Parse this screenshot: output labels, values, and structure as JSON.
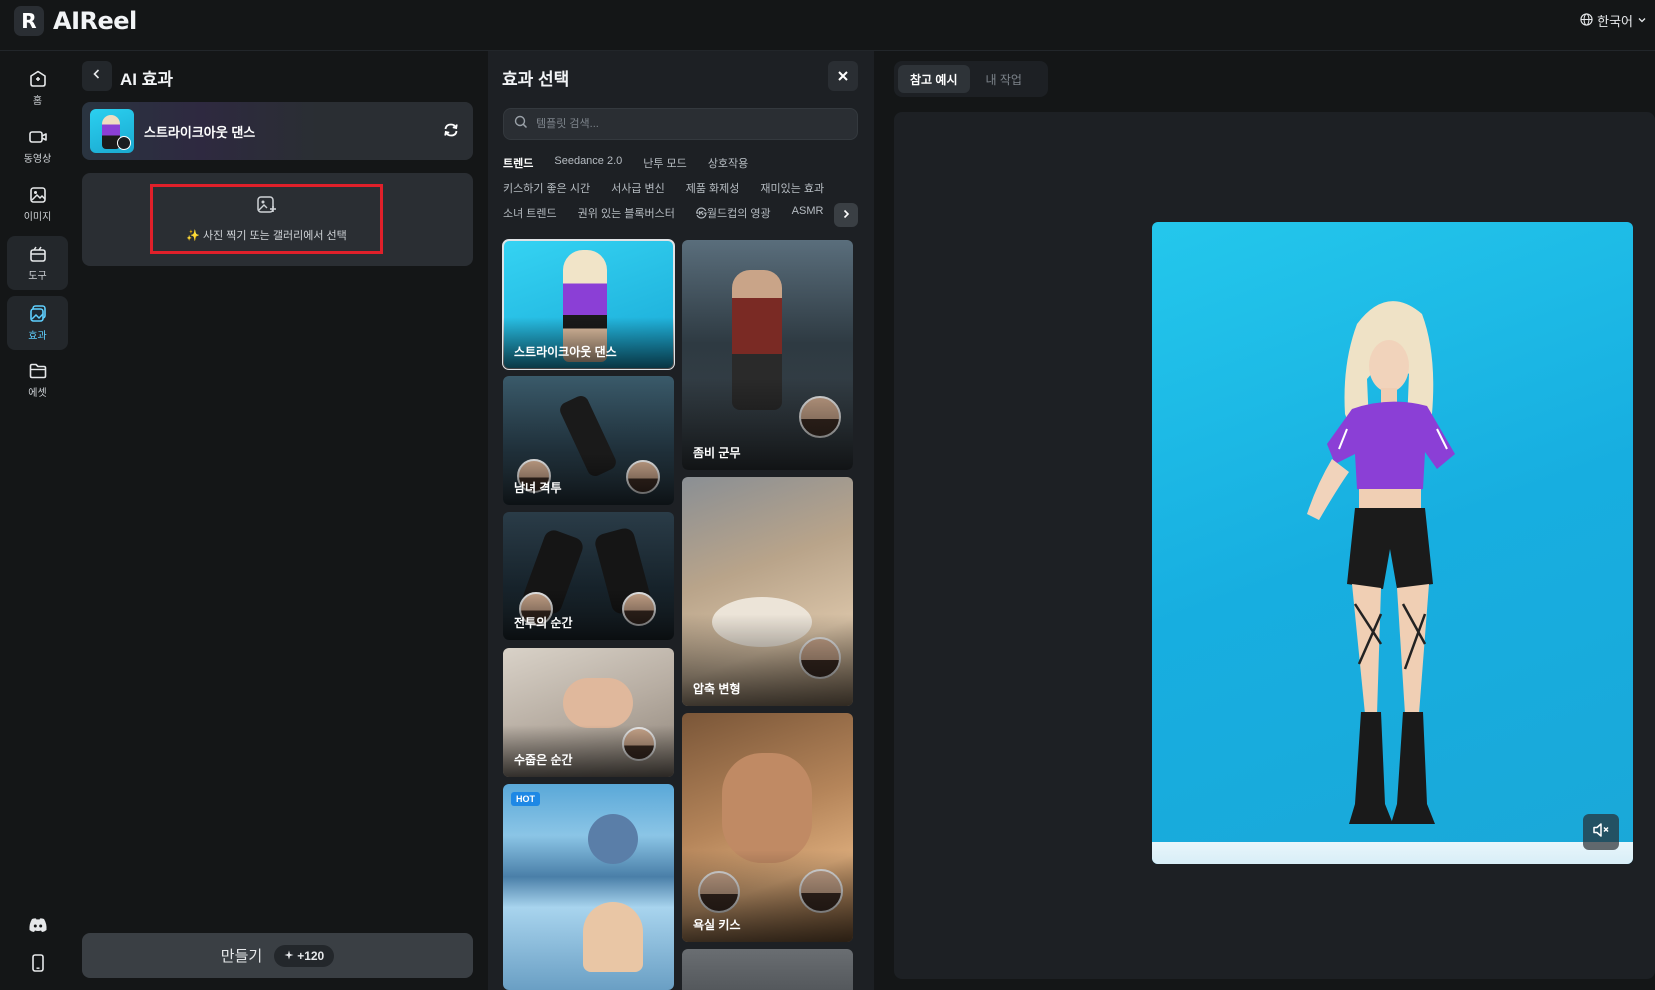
{
  "header": {
    "logo_mark": "R",
    "brand": "AIReel",
    "language": "한국어"
  },
  "sidebar": {
    "items": [
      {
        "label": "홈",
        "icon": "home-icon"
      },
      {
        "label": "동영상",
        "icon": "video-icon"
      },
      {
        "label": "이미지",
        "icon": "image-icon"
      },
      {
        "label": "도구",
        "icon": "tools-icon"
      },
      {
        "label": "효과",
        "icon": "effects-icon"
      },
      {
        "label": "에셋",
        "icon": "folder-icon"
      }
    ],
    "bottom_icons": [
      "discord-icon",
      "mobile-icon"
    ]
  },
  "left_panel": {
    "title": "AI 효과",
    "selected_effect": "스트라이크아웃 댄스",
    "upload_text": "✨ 사진 찍기 또는 갤러리에서 선택",
    "create_label": "만들기",
    "credit_cost": "+120"
  },
  "effect_select": {
    "title": "효과 선택",
    "search_placeholder": "템플릿 검색...",
    "tags_row1": [
      "트렌드",
      "Seedance 2.0",
      "난투 모드",
      "상호작용"
    ],
    "tags_row2": [
      "키스하기 좋은 시간",
      "서사급 변신",
      "제품 화제성",
      "재미있는 효과"
    ],
    "tags_row3": [
      "소녀 트렌드",
      "권위 있는 블록버스터",
      "㉿월드컵의 영광",
      "ASMR"
    ],
    "cards": [
      {
        "caption": "스트라이크아웃 댄스"
      },
      {
        "caption": "좀비 군무"
      },
      {
        "caption": "남녀 격투"
      },
      {
        "caption": "전투의 순간"
      },
      {
        "caption": "압축 변형"
      },
      {
        "caption": "수줍은 순간"
      },
      {
        "caption": "욕실 키스"
      },
      {
        "caption": "",
        "badge": "HOT"
      }
    ]
  },
  "preview": {
    "tabs": [
      "참고 예시",
      "내 작업"
    ],
    "active_tab": "참고 예시"
  },
  "colors": {
    "accent": "#5fd0ff",
    "highlight_border": "#e0202a",
    "background": "#141617",
    "panel": "#1d2024"
  }
}
